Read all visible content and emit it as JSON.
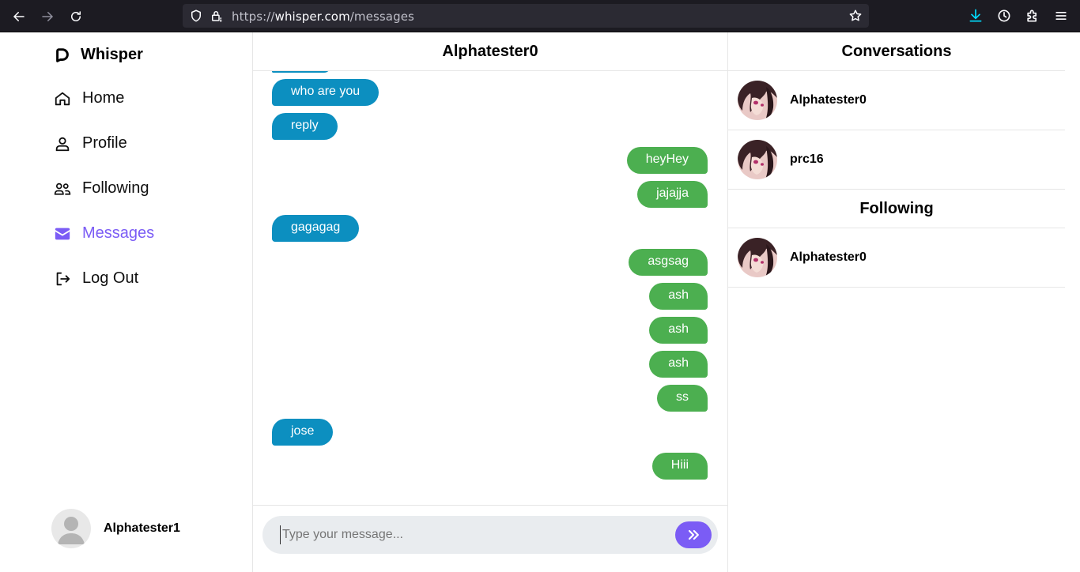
{
  "browser": {
    "url_scheme": "https://",
    "url_host": "whisper.com",
    "url_path": "/messages"
  },
  "app": {
    "brand": "Whisper",
    "accent_color": "#7b5cf5"
  },
  "sidebar": {
    "items": [
      {
        "label": "Home",
        "icon": "home-icon"
      },
      {
        "label": "Profile",
        "icon": "user-icon"
      },
      {
        "label": "Following",
        "icon": "users-icon"
      },
      {
        "label": "Messages",
        "icon": "envelope-icon",
        "active": true
      },
      {
        "label": "Log Out",
        "icon": "logout-icon"
      }
    ],
    "current_user": "Alphatester1"
  },
  "chat": {
    "title": "Alphatester0",
    "messages": [
      {
        "text": "who are you",
        "direction": "in"
      },
      {
        "text": "reply",
        "direction": "in"
      },
      {
        "text": "heyHey",
        "direction": "out"
      },
      {
        "text": "jajajja",
        "direction": "out"
      },
      {
        "text": "gagagag",
        "direction": "in"
      },
      {
        "text": "asgsag",
        "direction": "out"
      },
      {
        "text": "ash",
        "direction": "out"
      },
      {
        "text": "ash",
        "direction": "out"
      },
      {
        "text": "ash",
        "direction": "out"
      },
      {
        "text": "ss",
        "direction": "out"
      },
      {
        "text": "jose",
        "direction": "in"
      },
      {
        "text": "Hiii",
        "direction": "out"
      }
    ],
    "incoming_color": "#0c8fc0",
    "outgoing_color": "#4caf50",
    "input_placeholder": "Type your message..."
  },
  "right": {
    "conversations_title": "Conversations",
    "conversations": [
      {
        "name": "Alphatester0"
      },
      {
        "name": "prc16"
      }
    ],
    "following_title": "Following",
    "following": [
      {
        "name": "Alphatester0"
      }
    ]
  }
}
